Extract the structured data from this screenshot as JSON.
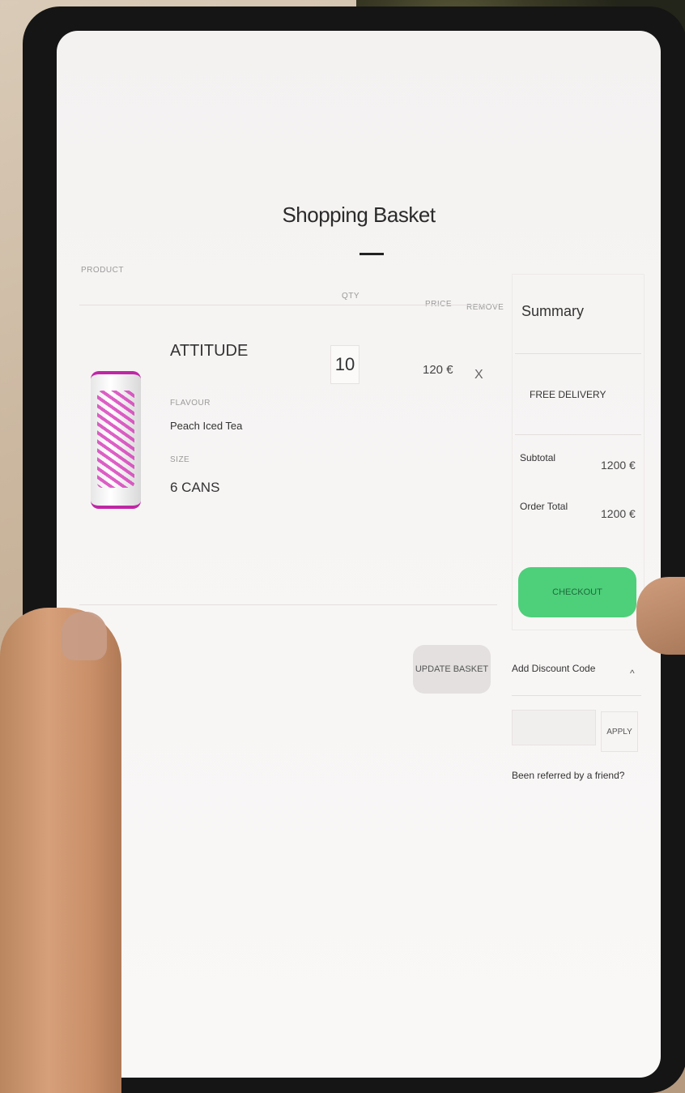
{
  "page": {
    "title": "Shopping Basket"
  },
  "columns": {
    "product": "PRODUCT",
    "qty": "QTY",
    "price": "PRICE",
    "remove": "REMOVE"
  },
  "item": {
    "name": "ATTITUDE",
    "flavour_label": "FLAVOUR",
    "flavour_value": "Peach Iced Tea",
    "size_label": "SIZE",
    "size_value": "6 CANS",
    "qty": "10",
    "price": "120 €",
    "remove_label": "X"
  },
  "buttons": {
    "update_basket": "UPDATE BASKET",
    "checkout": "CHECKOUT",
    "apply": "APPLY"
  },
  "summary": {
    "heading": "Summary",
    "delivery": "FREE DELIVERY",
    "subtotal_label": "Subtotal",
    "subtotal_value": "1200 €",
    "order_total_label": "Order Total",
    "order_total_value": "1200 €"
  },
  "discount": {
    "label": "Add Discount Code",
    "toggle": "^",
    "input_value": ""
  },
  "referral": {
    "text": "Been referred by a friend?"
  },
  "colors": {
    "checkout_green": "#4ecf7a",
    "can_accent": "#c026a6"
  }
}
